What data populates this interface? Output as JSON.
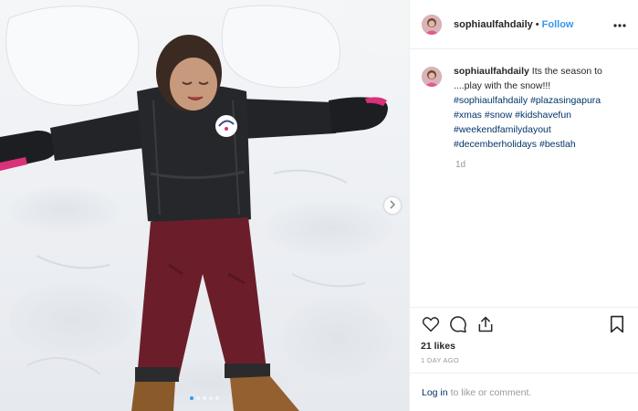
{
  "post": {
    "username": "sophiaulfahdaily",
    "separator": "•",
    "follow_label": "Follow",
    "more_icon": "more-horizontal-icon"
  },
  "caption": {
    "username": "sophiaulfahdaily",
    "text": "Its the season to ....play with the snow!!!",
    "hashtags": [
      "#sophiaulfahdaily",
      "#plazasingapura",
      "#xmas",
      "#snow",
      "#kidshavefun",
      "#weekendfamilydayout",
      "#decemberholidays",
      "#bestlah"
    ],
    "age": "1d"
  },
  "media": {
    "carousel_dots": 5,
    "active_dot": 0,
    "next_icon": "chevron-right-icon"
  },
  "engagement": {
    "likes_label": "21 likes",
    "timestamp": "1 DAY AGO",
    "icons": [
      "heart-icon",
      "comment-icon",
      "share-icon",
      "bookmark-icon"
    ]
  },
  "footer": {
    "login_link": "Log in",
    "login_suffix": "to like or comment."
  },
  "colors": {
    "link_blue": "#3897f0",
    "hashtag_blue": "#003569",
    "muted_gray": "#999999",
    "text_dark": "#262626"
  }
}
